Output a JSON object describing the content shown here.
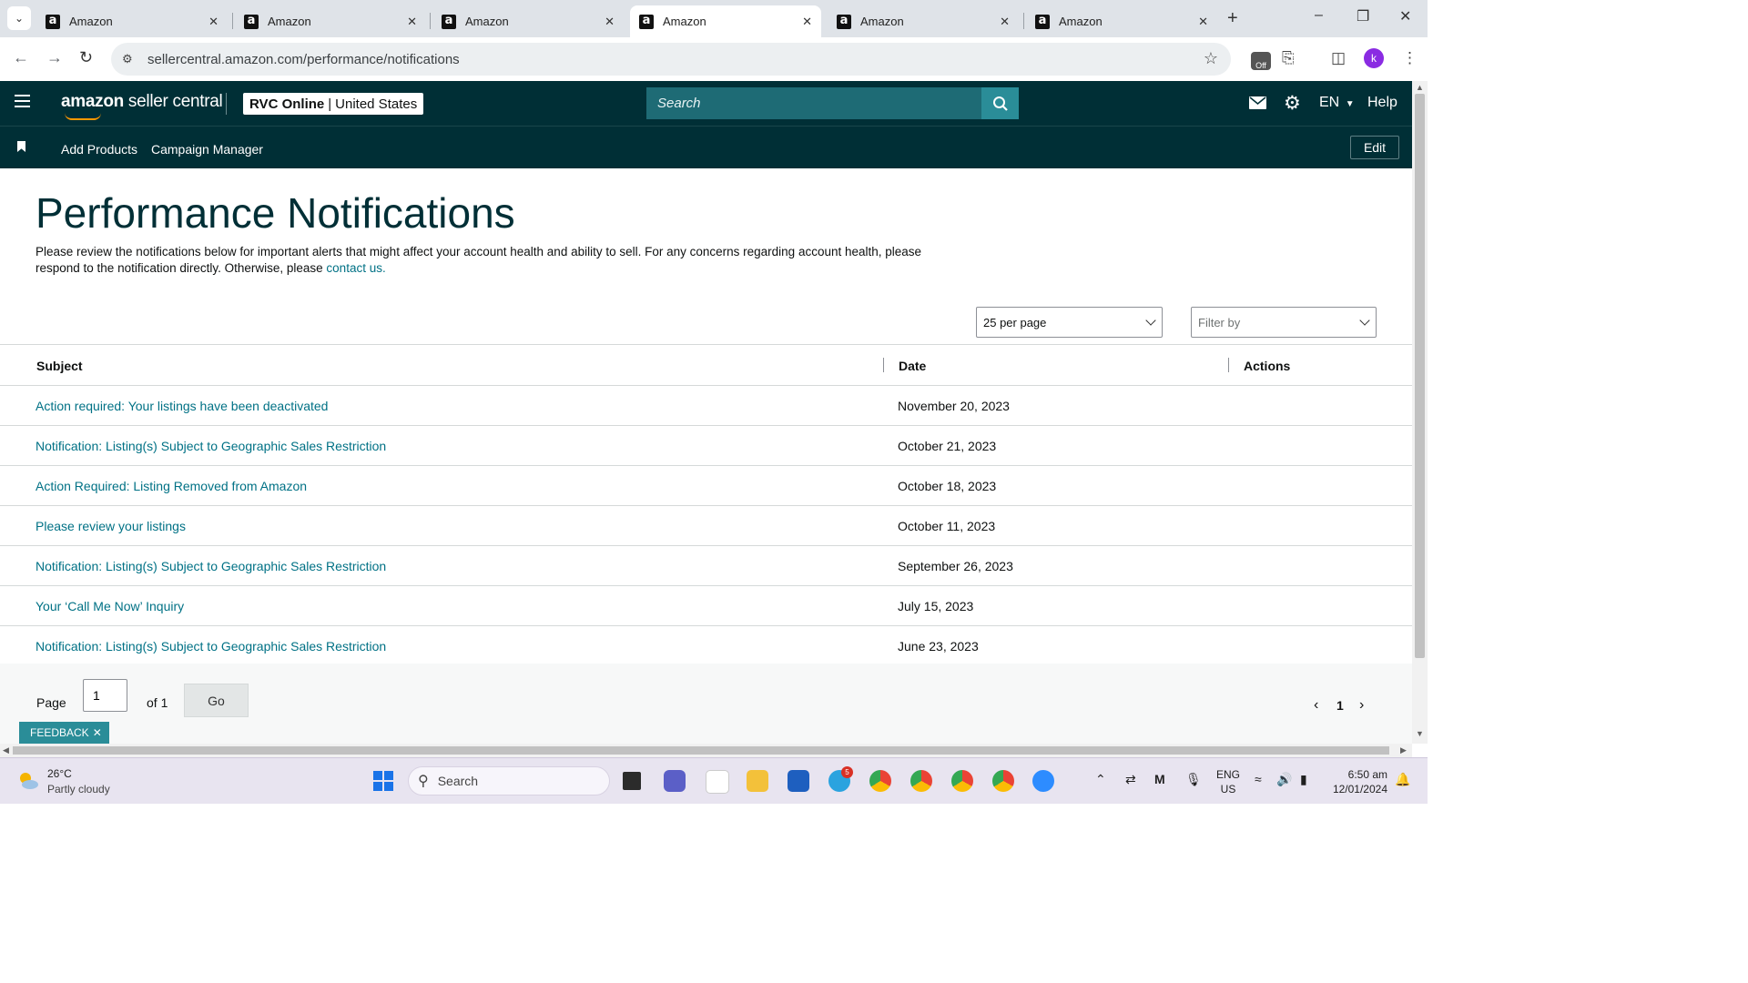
{
  "browser": {
    "tabs": [
      {
        "title": "Amazon",
        "active": false
      },
      {
        "title": "Amazon",
        "active": false
      },
      {
        "title": "Amazon",
        "active": false
      },
      {
        "title": "Amazon",
        "active": true
      },
      {
        "title": "Amazon",
        "active": false
      },
      {
        "title": "Amazon",
        "active": false
      }
    ],
    "url": "sellercentral.amazon.com/performance/notifications",
    "ext_badge": "Off",
    "profile_initial": "k"
  },
  "header": {
    "logo_bold": "amazon",
    "logo_rest": " seller central",
    "account_name": "RVC Online",
    "account_sep": "|",
    "marketplace": "United States",
    "search_placeholder": "Search",
    "language": "EN",
    "help": "Help"
  },
  "subnav": {
    "links": [
      "Add Products",
      "Campaign Manager"
    ],
    "edit": "Edit"
  },
  "page": {
    "title": "Performance Notifications",
    "intro": "Please review the notifications below for important alerts that might affect your account health and ability to sell. For any concerns regarding account health, please respond to the notification directly. Otherwise, please ",
    "contact_link": "contact us.",
    "per_page": "25 per page",
    "filter_placeholder": "Filter by"
  },
  "table": {
    "headers": {
      "subject": "Subject",
      "date": "Date",
      "actions": "Actions"
    },
    "rows": [
      {
        "subject": "Action required: Your listings have been deactivated",
        "date": "November 20, 2023"
      },
      {
        "subject": "Notification: Listing(s) Subject to Geographic Sales Restriction",
        "date": "October 21, 2023"
      },
      {
        "subject": "Action Required: Listing Removed from Amazon",
        "date": "October 18, 2023"
      },
      {
        "subject": "Please review your listings",
        "date": "October 11, 2023"
      },
      {
        "subject": "Notification: Listing(s) Subject to Geographic Sales Restriction",
        "date": "September 26, 2023"
      },
      {
        "subject": "Your ‘Call Me Now’ Inquiry",
        "date": "July 15, 2023"
      },
      {
        "subject": "Notification: Listing(s) Subject to Geographic Sales Restriction",
        "date": "June 23, 2023"
      }
    ]
  },
  "pagination": {
    "page_label": "Page",
    "current": "1",
    "of_label": "of 1",
    "go": "Go",
    "page_number": "1"
  },
  "feedback": "FEEDBACK",
  "taskbar": {
    "temperature": "26°C",
    "weather": "Partly cloudy",
    "search": "Search",
    "telegram_badge": "5",
    "lang_line1": "ENG",
    "lang_line2": "US",
    "time": "6:50 am",
    "date": "12/01/2024"
  },
  "colors": {
    "header_bg": "#002f36",
    "link": "#007185",
    "search_bg": "#1e6b75",
    "search_btn": "#2a8d98",
    "title": "#002f36"
  }
}
